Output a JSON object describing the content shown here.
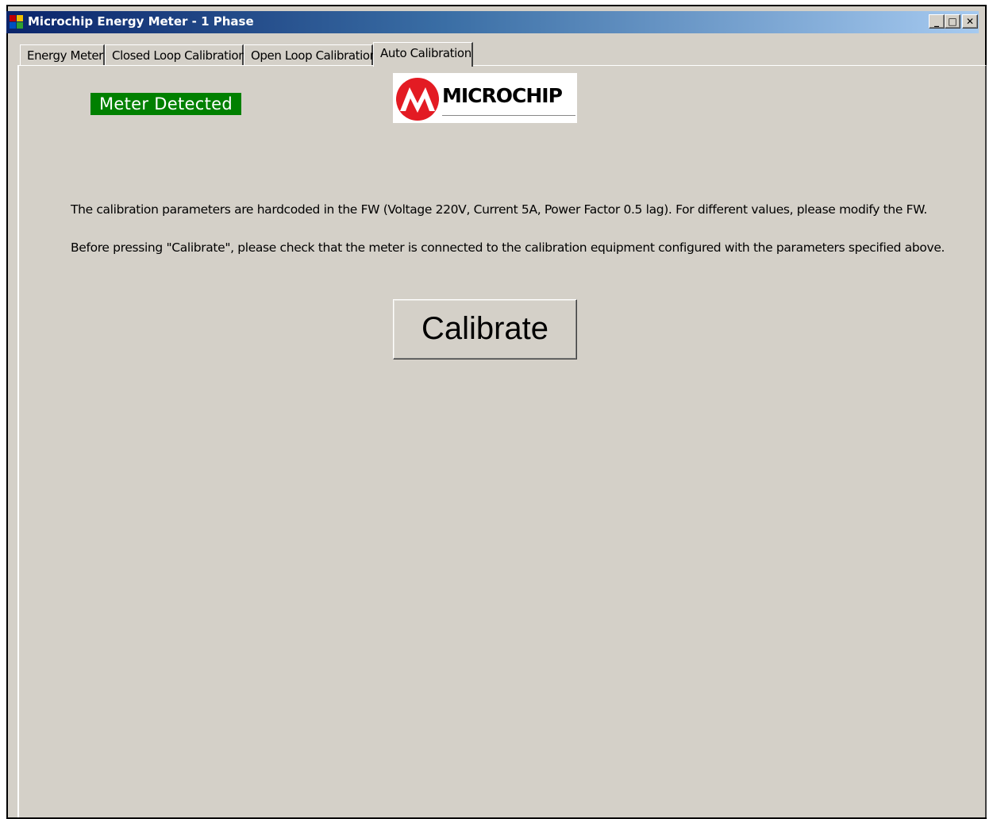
{
  "window": {
    "title": "Microchip Energy Meter - 1 Phase",
    "buttons": {
      "minimize": "_",
      "maximize": "□",
      "close": "✕"
    }
  },
  "tabs": [
    {
      "label": "Energy Meter",
      "active": false
    },
    {
      "label": "Closed Loop Calibration",
      "active": false
    },
    {
      "label": "Open Loop Calibration",
      "active": false
    },
    {
      "label": "Auto Calibration",
      "active": true
    }
  ],
  "status": {
    "text": "Meter Detected",
    "color": "#008000"
  },
  "logo": {
    "text": "MICROCHIP",
    "accent": "#e31b23"
  },
  "instructions": [
    "The calibration parameters are hardcoded in the FW (Voltage 220V, Current 5A, Power Factor 0.5 lag).  For different values, please modify the FW.",
    "Before pressing \"Calibrate\", please check that the meter is connected to the calibration equipment configured with the parameters specified above."
  ],
  "calibrate_button": {
    "label": "Calibrate"
  }
}
